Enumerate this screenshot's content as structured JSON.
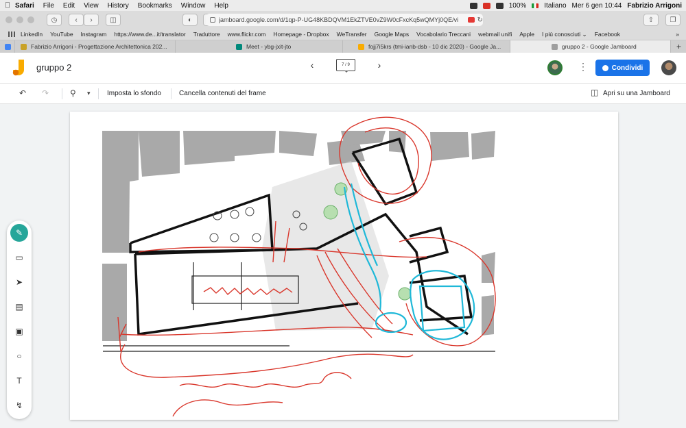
{
  "menubar": {
    "apple": "",
    "app_name": "Safari",
    "items": [
      "File",
      "Edit",
      "View",
      "History",
      "Bookmarks",
      "Window",
      "Help"
    ],
    "battery": "100%",
    "language": "Italiano",
    "datetime": "Mer 6 gen  10:44",
    "user": "Fabrizio Arrigoni"
  },
  "browser": {
    "url": "jamboard.google.com/d/1qp-P-UG48KBDQVM1EkZTVE0vZ9W0cFxcKq5wQMYj0QE/vi",
    "bookmarks": [
      "LinkedIn",
      "YouTube",
      "Instagram",
      "https://www.de...it/translator",
      "Traduttore",
      "www.flickr.com",
      "Homepage - Dropbox",
      "WeTransfer",
      "Google Maps",
      "Vocabolario Treccani",
      "webmail unifi",
      "Apple",
      "I più conosciuti ⌄",
      "Facebook"
    ],
    "tabs": [
      {
        "label": "Fabrizio Arrigoni - Progettazione Architettonica 202...",
        "color": "#c9a227"
      },
      {
        "label": "Meet - ybg-jxit-jto",
        "color": "#00897b"
      },
      {
        "label": "fojj7i5krs (tmi-ianb-dsb - 10 dic 2020) - Google Ja...",
        "color": "#f9ab00"
      },
      {
        "label": "gruppo 2 - Google Jamboard",
        "color": "#9e9e9e"
      }
    ]
  },
  "jamboard": {
    "title": "gruppo 2",
    "frame_counter": "7 / 9",
    "share_label": "Condividi",
    "toolbar": {
      "set_background": "Imposta lo sfondo",
      "clear_frame": "Cancella contenuti del frame",
      "open_in_jamboard": "Apri su una Jamboard"
    },
    "tools": [
      "pen-icon",
      "eraser-icon",
      "select-icon",
      "sticky-note-icon",
      "image-icon",
      "circle-icon",
      "text-box-icon",
      "laser-icon"
    ],
    "colors": {
      "accent": "#1a73e8",
      "pen_active": "#26a69a",
      "sketch_red": "#d9362b",
      "sketch_cyan": "#1fb8d8"
    }
  }
}
